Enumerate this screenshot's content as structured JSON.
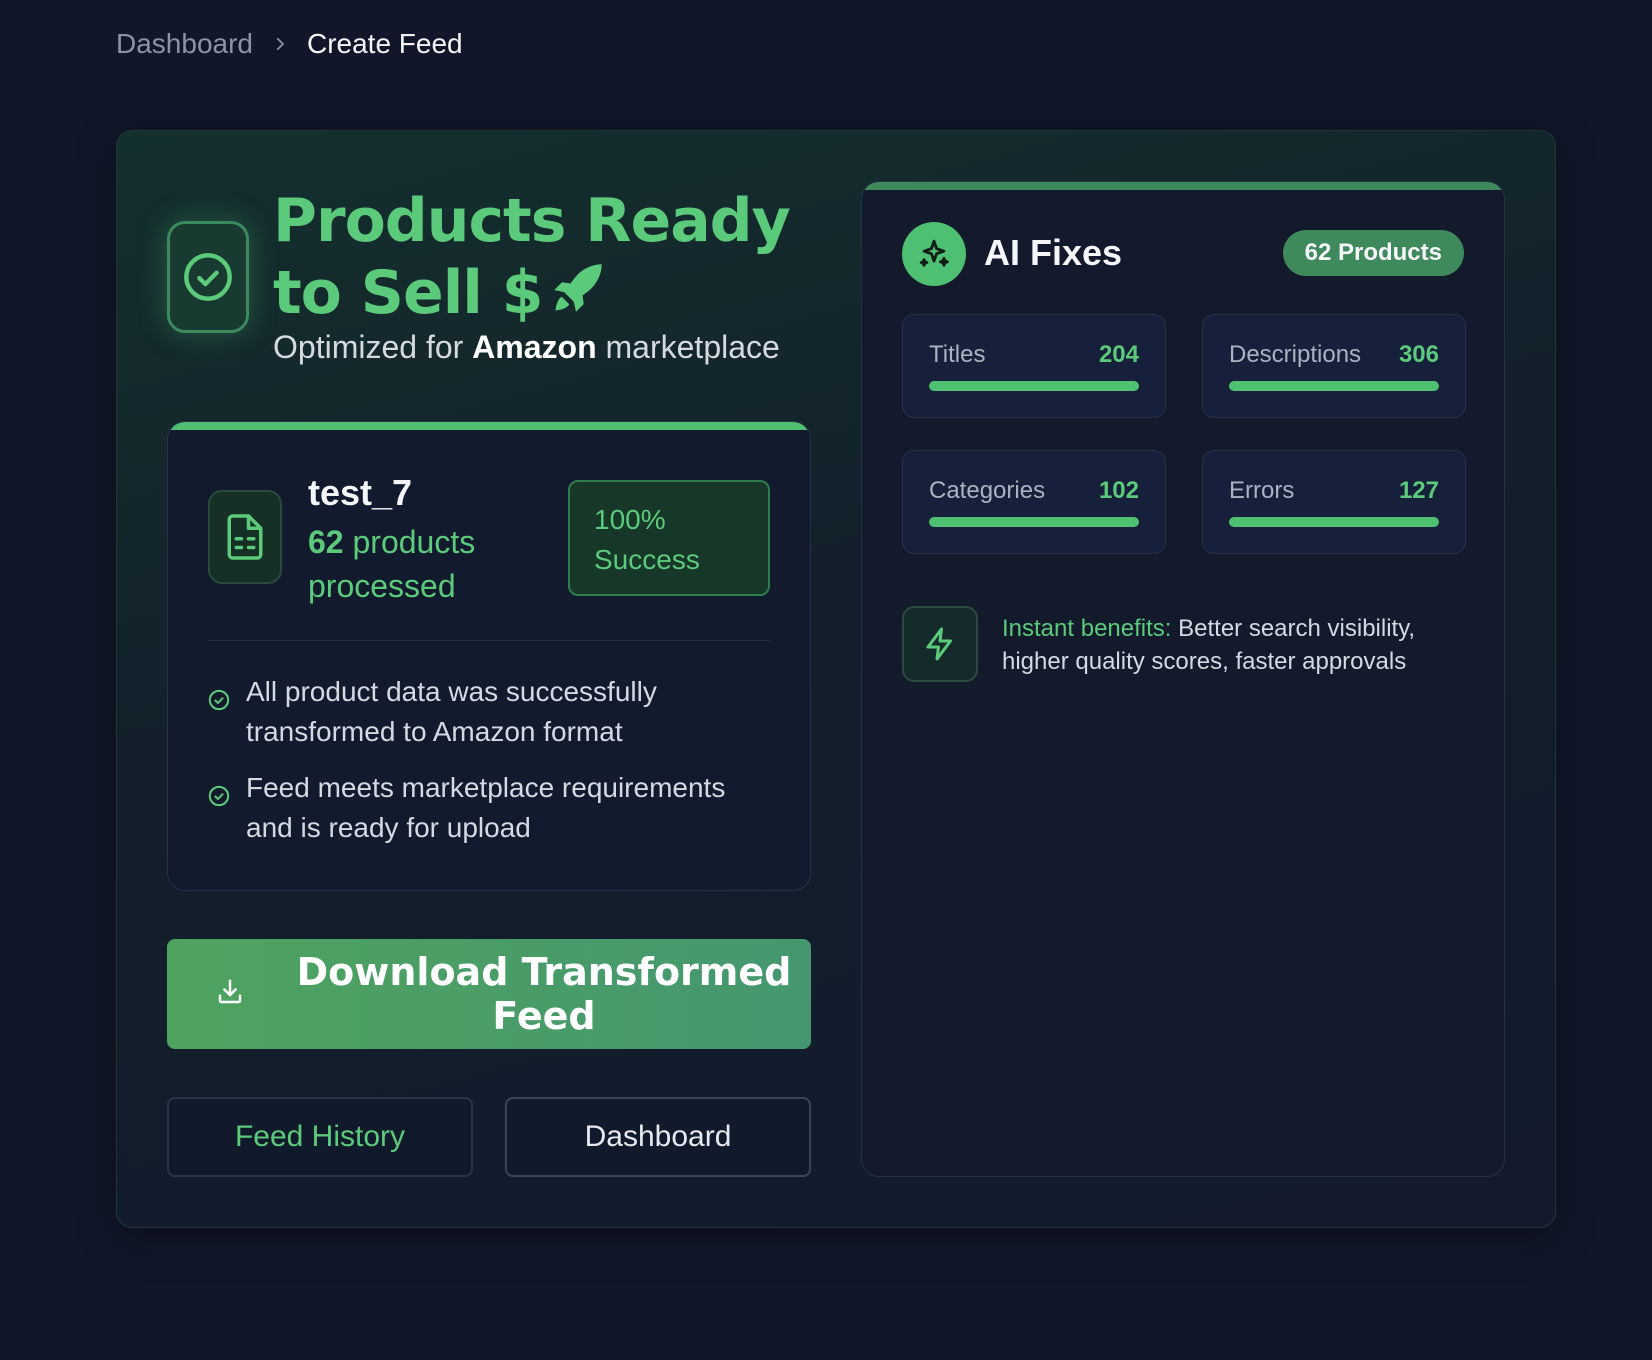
{
  "breadcrumb": {
    "parent": "Dashboard",
    "current": "Create Feed"
  },
  "hero": {
    "title": "Products Ready to Sell $",
    "subtitle_prefix": "Optimized for ",
    "marketplace": "Amazon",
    "subtitle_suffix": " marketplace"
  },
  "file": {
    "name": "test_7",
    "count": "62",
    "count_suffix": " products processed",
    "success": "100% Success",
    "checks": [
      "All product data was successfully transformed to Amazon format",
      "Feed meets marketplace requirements and is ready for upload"
    ]
  },
  "actions": {
    "download": "Download Transformed Feed",
    "history": "Feed History",
    "dashboard": "Dashboard"
  },
  "ai_fixes": {
    "title": "AI Fixes",
    "badge": "62 Products",
    "metrics": [
      {
        "label": "Titles",
        "value": "204",
        "fill": 1.0
      },
      {
        "label": "Descriptions",
        "value": "306",
        "fill": 1.0
      },
      {
        "label": "Categories",
        "value": "102",
        "fill": 1.0
      },
      {
        "label": "Errors",
        "value": "127",
        "fill": 1.0
      }
    ],
    "benefit_label": "Instant benefits:",
    "benefit_text": " Better search visibility, higher quality scores, faster approvals"
  },
  "colors": {
    "accent": "#5bca7a",
    "background": "#111729",
    "bar": "#4fbf71"
  },
  "icons": [
    "chevron-right-icon",
    "check-circle-icon",
    "rocket-icon",
    "file-spreadsheet-icon",
    "download-icon",
    "sparkles-icon",
    "zap-icon"
  ]
}
